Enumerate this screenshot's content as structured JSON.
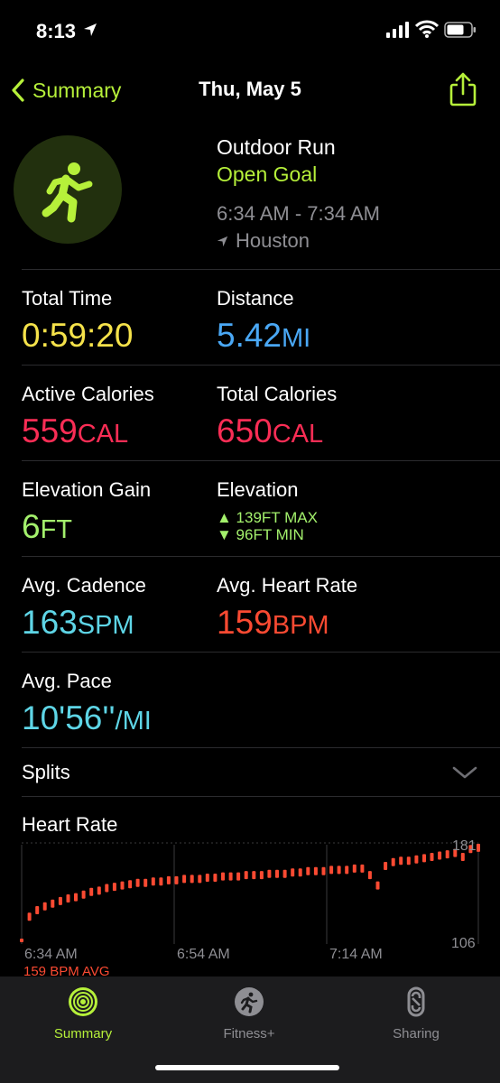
{
  "status": {
    "time": "8:13"
  },
  "nav": {
    "back_label": "Summary",
    "title": "Thu, May 5"
  },
  "workout": {
    "type": "Outdoor Run",
    "goal": "Open Goal",
    "time_range": "6:34 AM - 7:34 AM",
    "location": "Houston"
  },
  "metrics": {
    "total_time": {
      "label": "Total Time",
      "value": "0:59:20",
      "color": "#f5e24a"
    },
    "distance": {
      "label": "Distance",
      "value": "5.42",
      "unit": "MI",
      "color": "#4aa8f5"
    },
    "active_calories": {
      "label": "Active Calories",
      "value": "559",
      "unit": "CAL",
      "color": "#fa2d55"
    },
    "total_calories": {
      "label": "Total Calories",
      "value": "650",
      "unit": "CAL",
      "color": "#fa2d55"
    },
    "elevation_gain": {
      "label": "Elevation Gain",
      "value": "6",
      "unit": "FT",
      "color": "#a3f06c"
    },
    "elevation": {
      "label": "Elevation",
      "max": "▲ 139FT MAX",
      "min": "▼ 96FT MIN"
    },
    "avg_cadence": {
      "label": "Avg. Cadence",
      "value": "163",
      "unit": "SPM",
      "color": "#5ed5e6"
    },
    "avg_heart_rate": {
      "label": "Avg. Heart Rate",
      "value": "159",
      "unit": "BPM",
      "color": "#fa4a32"
    },
    "avg_pace": {
      "label": "Avg. Pace",
      "value": "10'56''",
      "unit": "/MI",
      "color": "#5ed5e6"
    }
  },
  "splits": {
    "label": "Splits"
  },
  "heart_rate": {
    "title": "Heart Rate",
    "max_label": "181",
    "min_label": "106",
    "avg_label": "159 BPM AVG",
    "time_labels": [
      "6:34 AM",
      "6:54 AM",
      "7:14 AM"
    ],
    "line_color": "#fa4a32"
  },
  "chart_data": {
    "type": "scatter",
    "title": "Heart Rate",
    "x": [
      0,
      1,
      2,
      3,
      4,
      5,
      6,
      7,
      8,
      9,
      10,
      11,
      12,
      13,
      14,
      15,
      16,
      17,
      18,
      19,
      20,
      21,
      22,
      23,
      24,
      25,
      26,
      27,
      28,
      29,
      30,
      31,
      32,
      33,
      34,
      35,
      36,
      37,
      38,
      39,
      40,
      41,
      42,
      43,
      44,
      45,
      46,
      47,
      48,
      49,
      50,
      51,
      52,
      53,
      54,
      55,
      56,
      57,
      58,
      59
    ],
    "series": [
      {
        "values": [
          106,
          126,
          131,
          134,
          136,
          138,
          140,
          141,
          143,
          145,
          146,
          148,
          149,
          150,
          151,
          152,
          152,
          153,
          153,
          154,
          154,
          155,
          155,
          155,
          156,
          156,
          157,
          157,
          157,
          158,
          158,
          158,
          159,
          159,
          159,
          160,
          160,
          161,
          161,
          161,
          162,
          162,
          162,
          163,
          163,
          158,
          150,
          165,
          168,
          169,
          169,
          170,
          171,
          172,
          173,
          174,
          175,
          172,
          178,
          179
        ]
      }
    ],
    "ylim": [
      106,
      181
    ],
    "xlabel": "",
    "ylabel": "",
    "grid": true
  },
  "tabs": [
    {
      "label": "Summary",
      "icon": "activity-rings-icon",
      "color": "#b6f03a"
    },
    {
      "label": "Fitness+",
      "icon": "fitness-plus-icon",
      "color": "#8e8e93"
    },
    {
      "label": "Sharing",
      "icon": "sharing-icon",
      "color": "#8e8e93"
    }
  ]
}
